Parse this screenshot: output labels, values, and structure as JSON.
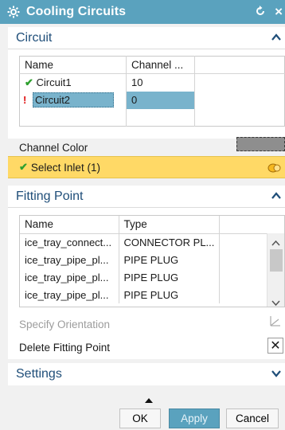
{
  "window": {
    "title": "Cooling Circuits"
  },
  "circuit": {
    "header": "Circuit",
    "columns": [
      "Name",
      "Channel ..."
    ],
    "rows": [
      {
        "name": "Circuit1",
        "channel": "10",
        "status": "ok"
      },
      {
        "name": "Circuit2",
        "channel": "0",
        "status": "error"
      }
    ],
    "channel_color_label": "Channel Color",
    "select_inlet_label": "Select Inlet (1)"
  },
  "fitting": {
    "header": "Fitting Point",
    "columns": [
      "Name",
      "Type"
    ],
    "rows": [
      {
        "name": "ice_tray_connect...",
        "type": "CONNECTOR PL..."
      },
      {
        "name": "ice_tray_pipe_pl...",
        "type": "PIPE PLUG"
      },
      {
        "name": "ice_tray_pipe_pl...",
        "type": "PIPE PLUG"
      },
      {
        "name": "ice_tray_pipe_pl...",
        "type": "PIPE PLUG"
      }
    ],
    "specify_orientation": "Specify Orientation",
    "delete_fitting_point": "Delete Fitting Point"
  },
  "settings": {
    "header": "Settings"
  },
  "buttons": {
    "ok": "OK",
    "apply": "Apply",
    "cancel": "Cancel"
  },
  "colors": {
    "titlebar": "#5aa2be",
    "header_text": "#1f4e79",
    "check": "#2ea02e",
    "error": "#e01010",
    "selected_row": "#79b3cc",
    "inlet_bar": "#ffd966",
    "apply_bg": "#5aa2be"
  }
}
